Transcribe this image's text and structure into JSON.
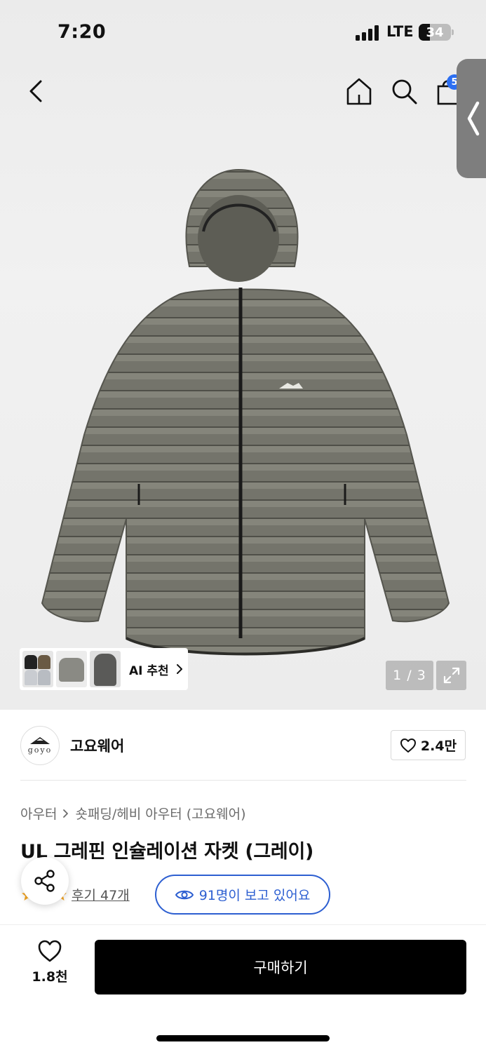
{
  "status_bar": {
    "time": "7:20",
    "network": "LTE",
    "battery_level": "34"
  },
  "header": {
    "cart_badge": "5"
  },
  "gallery": {
    "ai_reco_label": "AI 추천",
    "counter": "1 / 3"
  },
  "brand": {
    "logo_text": "goyo",
    "name": "고요웨어",
    "like_count": "2.4만"
  },
  "product": {
    "breadcrumb": [
      "아우터",
      "숏패딩/헤비 아우터 (고요웨어)"
    ],
    "title": "UL 그레핀 인슐레이션 자켓 (그레이)",
    "review_link": "후기 47개",
    "viewers_text": "91명이 보고 있어요"
  },
  "bottom_bar": {
    "wish_count": "1.8천",
    "buy_label": "구매하기"
  },
  "colors": {
    "accent_blue": "#2d5fd1",
    "badge_blue": "#2c6ff2",
    "buy_button": "#000000",
    "jacket_gray": "#6f6f66"
  }
}
